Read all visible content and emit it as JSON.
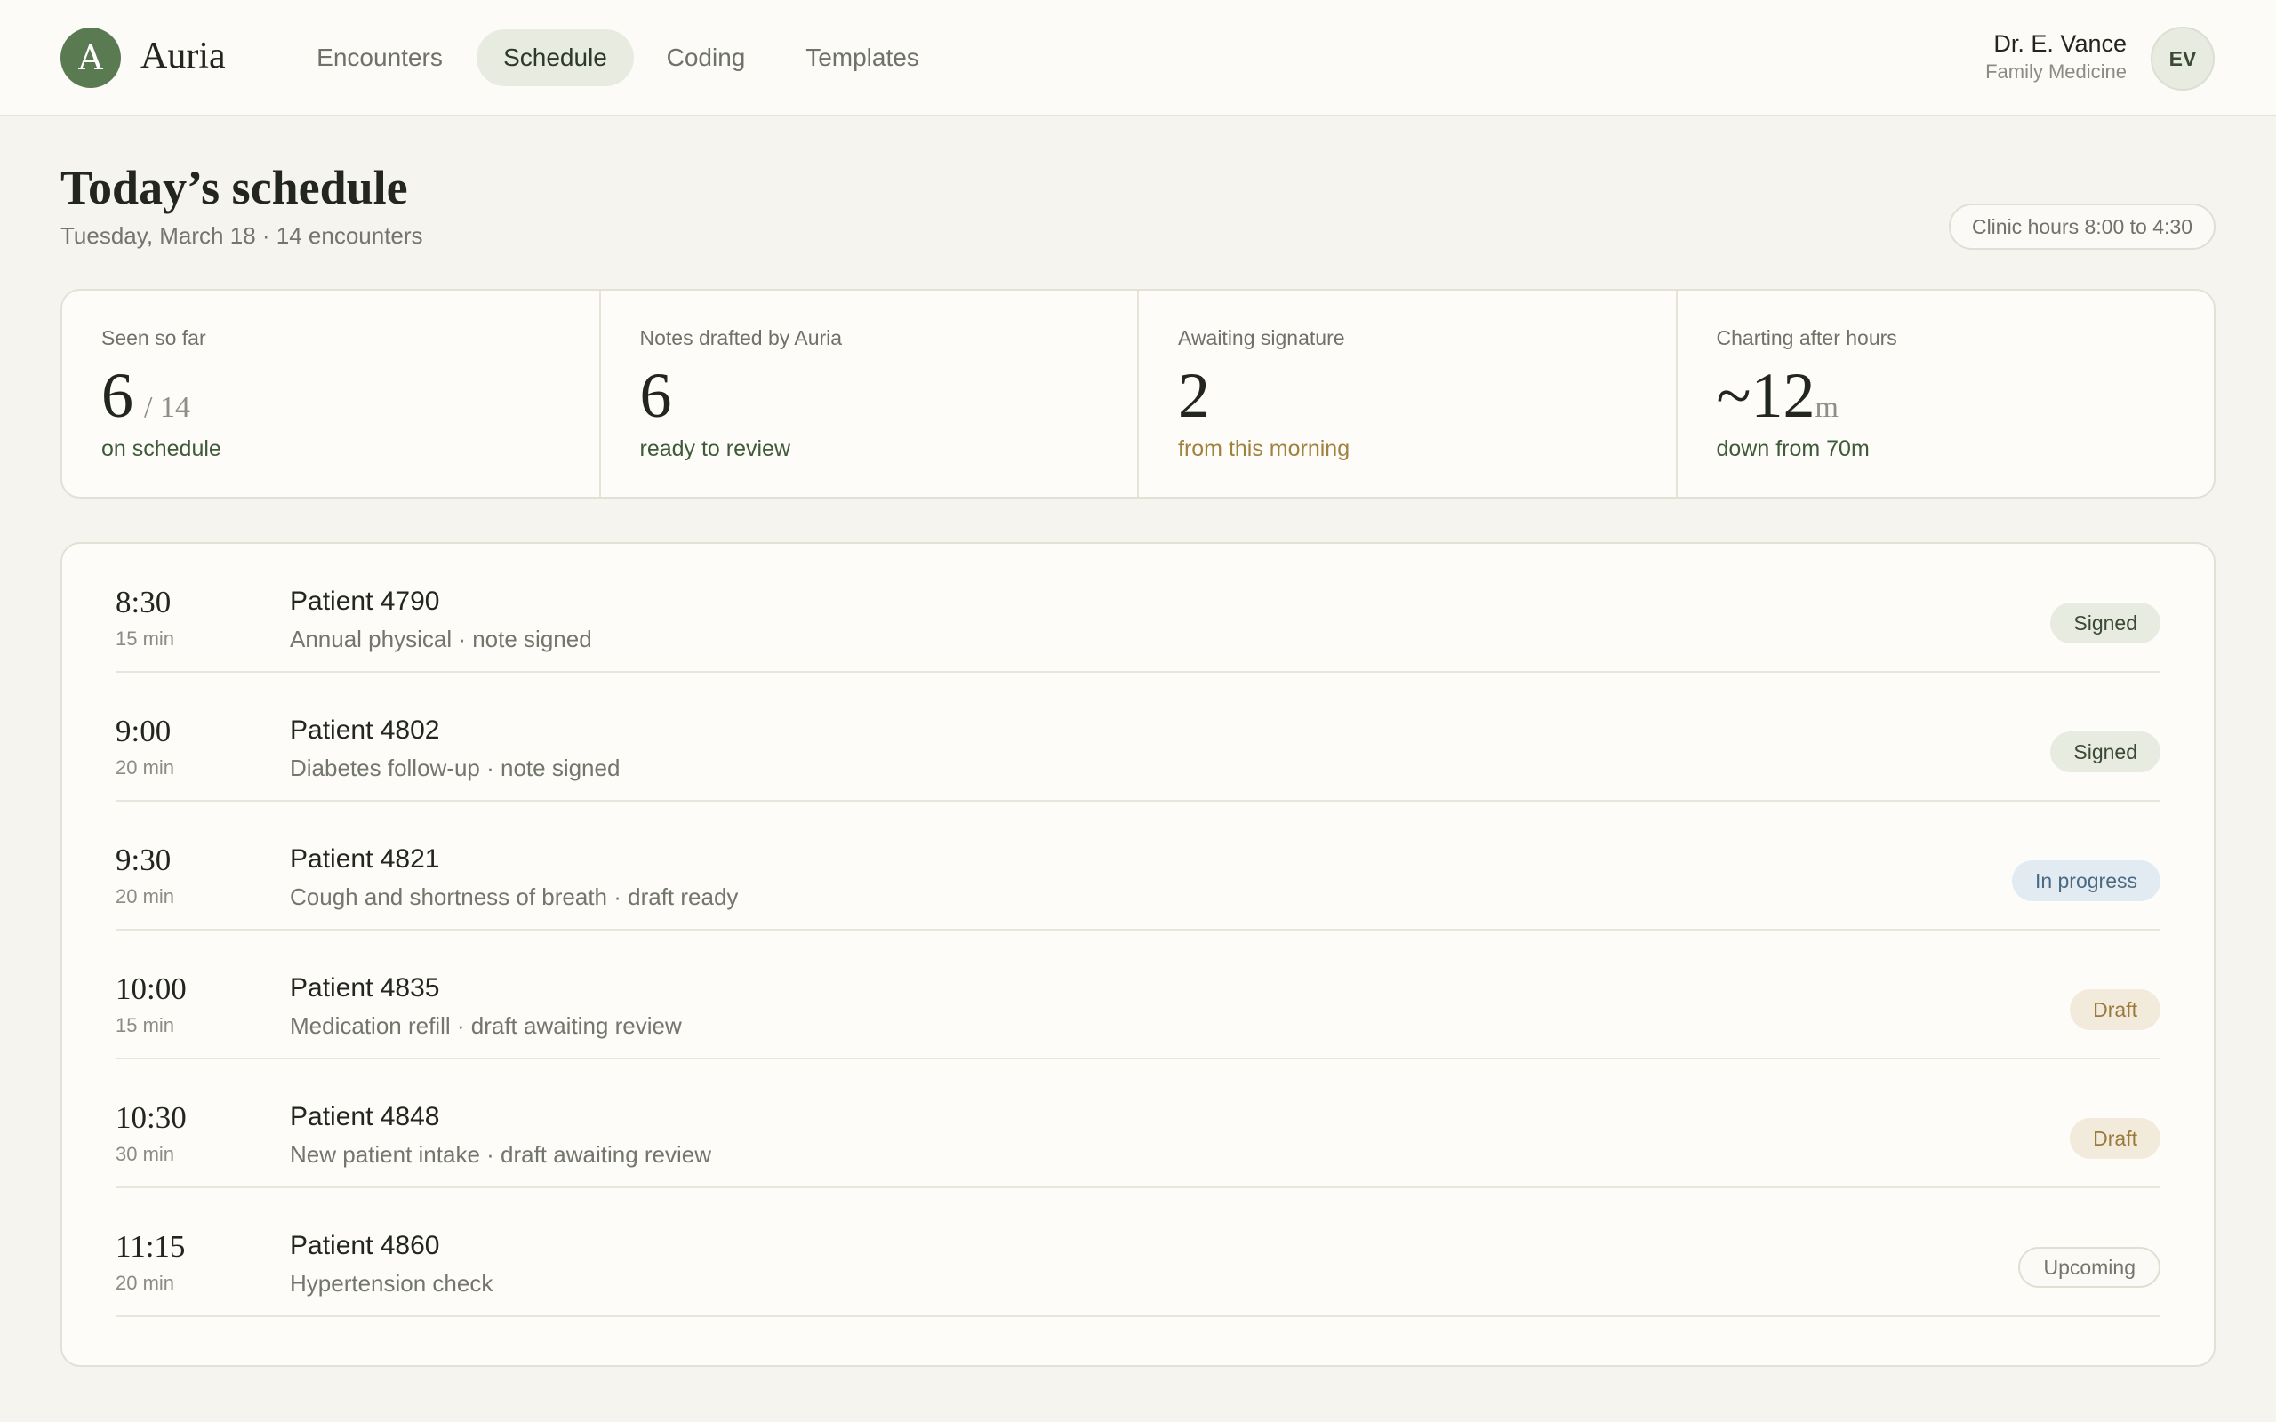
{
  "app": {
    "logo_letter": "A",
    "name": "Auria"
  },
  "nav": {
    "items": [
      {
        "label": "Encounters",
        "active": false
      },
      {
        "label": "Schedule",
        "active": true
      },
      {
        "label": "Coding",
        "active": false
      },
      {
        "label": "Templates",
        "active": false
      }
    ]
  },
  "user": {
    "name": "Dr. E. Vance",
    "specialty": "Family Medicine",
    "initials": "EV"
  },
  "page": {
    "title": "Today’s schedule",
    "subtitle": "Tuesday, March 18 · 14 encounters",
    "clinic_hours": "Clinic hours 8:00 to 4:30"
  },
  "stats": [
    {
      "label": "Seen so far",
      "value": "6",
      "suffix": "/ 14",
      "note": "on schedule",
      "note_tone": "green"
    },
    {
      "label": "Notes drafted by Auria",
      "value": "6",
      "suffix": "",
      "note": "ready to review",
      "note_tone": "green"
    },
    {
      "label": "Awaiting signature",
      "value": "2",
      "suffix": "",
      "note": "from this morning",
      "note_tone": "amber"
    },
    {
      "label": "Charting after hours",
      "value": "~12",
      "suffix": "m",
      "note": "down from 70m",
      "note_tone": "green"
    }
  ],
  "schedule": {
    "rows": [
      {
        "time": "8:30",
        "duration": "15 min",
        "patient": "Patient 4790",
        "description": "Annual physical · note signed",
        "status": "Signed",
        "status_kind": "signed"
      },
      {
        "time": "9:00",
        "duration": "20 min",
        "patient": "Patient 4802",
        "description": "Diabetes follow-up · note signed",
        "status": "Signed",
        "status_kind": "signed"
      },
      {
        "time": "9:30",
        "duration": "20 min",
        "patient": "Patient 4821",
        "description": "Cough and shortness of breath · draft ready",
        "status": "In progress",
        "status_kind": "progress"
      },
      {
        "time": "10:00",
        "duration": "15 min",
        "patient": "Patient 4835",
        "description": "Medication refill · draft awaiting review",
        "status": "Draft",
        "status_kind": "draft"
      },
      {
        "time": "10:30",
        "duration": "30 min",
        "patient": "Patient 4848",
        "description": "New patient intake · draft awaiting review",
        "status": "Draft",
        "status_kind": "draft"
      },
      {
        "time": "11:15",
        "duration": "20 min",
        "patient": "Patient 4860",
        "description": "Hypertension check",
        "status": "Upcoming",
        "status_kind": "upcoming"
      }
    ]
  },
  "colors": {
    "brand": "#5a7a52",
    "background": "#f6f4ef",
    "signed": "#e7ebe0",
    "in_progress": "#e2ebf2",
    "draft": "#f2ebdc"
  }
}
